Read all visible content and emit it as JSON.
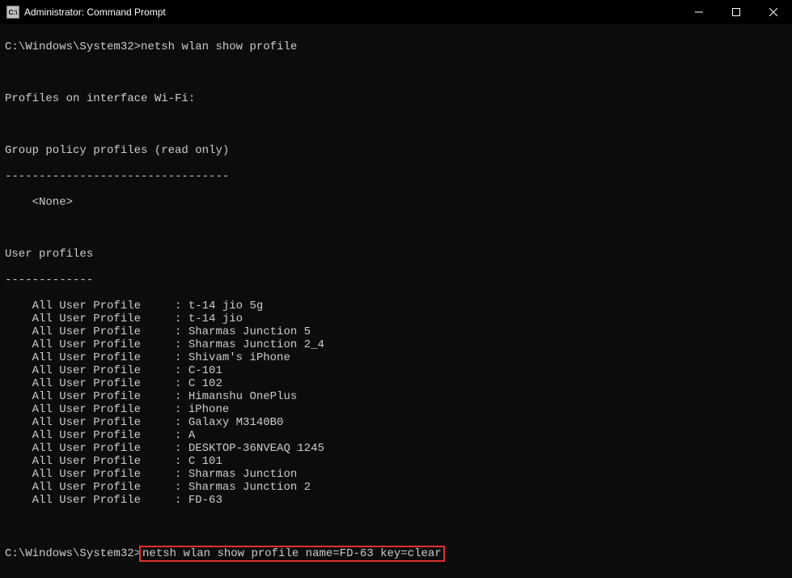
{
  "window": {
    "title": "Administrator: Command Prompt",
    "icon_label": "C:\\"
  },
  "prompt1": {
    "path": "C:\\Windows\\System32>",
    "command": "netsh wlan show profile"
  },
  "output": {
    "interface_header": "Profiles on interface Wi-Fi:",
    "group_policy_header": "Group policy profiles (read only)",
    "group_policy_divider": "---------------------------------",
    "group_policy_value": "    <None>",
    "user_profiles_header": "User profiles",
    "user_profiles_divider": "-------------",
    "profiles": [
      {
        "label": "    All User Profile     : ",
        "name": "t-14 jio 5g"
      },
      {
        "label": "    All User Profile     : ",
        "name": "t-14 jio"
      },
      {
        "label": "    All User Profile     : ",
        "name": "Sharmas Junction 5"
      },
      {
        "label": "    All User Profile     : ",
        "name": "Sharmas Junction 2_4"
      },
      {
        "label": "    All User Profile     : ",
        "name": "Shivam's iPhone"
      },
      {
        "label": "    All User Profile     : ",
        "name": "C-101"
      },
      {
        "label": "    All User Profile     : ",
        "name": "C 102"
      },
      {
        "label": "    All User Profile     : ",
        "name": "Himanshu OnePlus"
      },
      {
        "label": "    All User Profile     : ",
        "name": "iPhone"
      },
      {
        "label": "    All User Profile     : ",
        "name": "Galaxy M3140B0"
      },
      {
        "label": "    All User Profile     : ",
        "name": "A"
      },
      {
        "label": "    All User Profile     : ",
        "name": "DESKTOP-36NVEAQ 1245"
      },
      {
        "label": "    All User Profile     : ",
        "name": "C 101"
      },
      {
        "label": "    All User Profile     : ",
        "name": "Sharmas Junction"
      },
      {
        "label": "    All User Profile     : ",
        "name": "Sharmas Junction 2"
      },
      {
        "label": "    All User Profile     : ",
        "name": "FD-63"
      }
    ]
  },
  "prompt2": {
    "path": "C:\\Windows\\System32>",
    "command": "netsh wlan show profile name=FD-63 key=clear"
  }
}
